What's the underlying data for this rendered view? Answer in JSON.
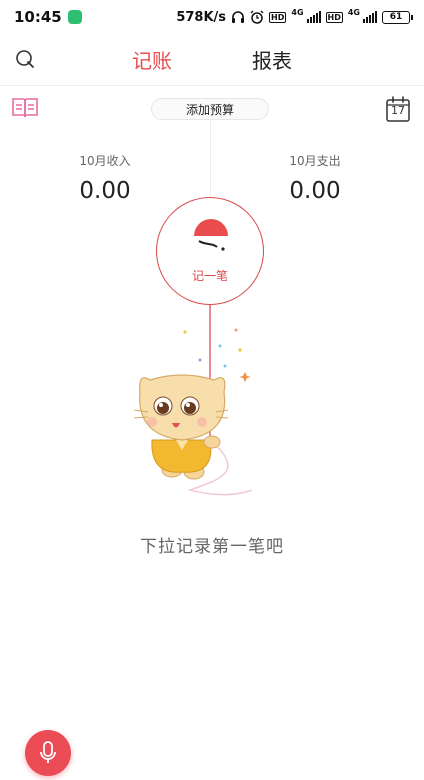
{
  "status_bar": {
    "time": "10:45",
    "net_speed": "578K/s",
    "signal_tag": "4G",
    "hd_tag": "HD",
    "battery": "61"
  },
  "header": {
    "tabs": [
      {
        "label": "记账",
        "active": true
      },
      {
        "label": "报表",
        "active": false
      }
    ],
    "search_icon": "search-icon"
  },
  "toolbar": {
    "budget_label": "添加预算",
    "calendar_day": "17",
    "book_icon": "book-icon",
    "calendar_icon": "calendar-icon"
  },
  "summary": {
    "income_label": "10月收入",
    "income_value": "0.00",
    "expense_label": "10月支出",
    "expense_value": "0.00"
  },
  "record": {
    "label": "记一笔"
  },
  "empty_hint": "下拉记录第一笔吧",
  "voice": {
    "icon": "microphone-icon"
  },
  "colors": {
    "accent": "#e84c4c",
    "voice_button": "#ea4b55",
    "mascot_body": "#f5d59a",
    "mascot_shirt": "#f2b830"
  }
}
